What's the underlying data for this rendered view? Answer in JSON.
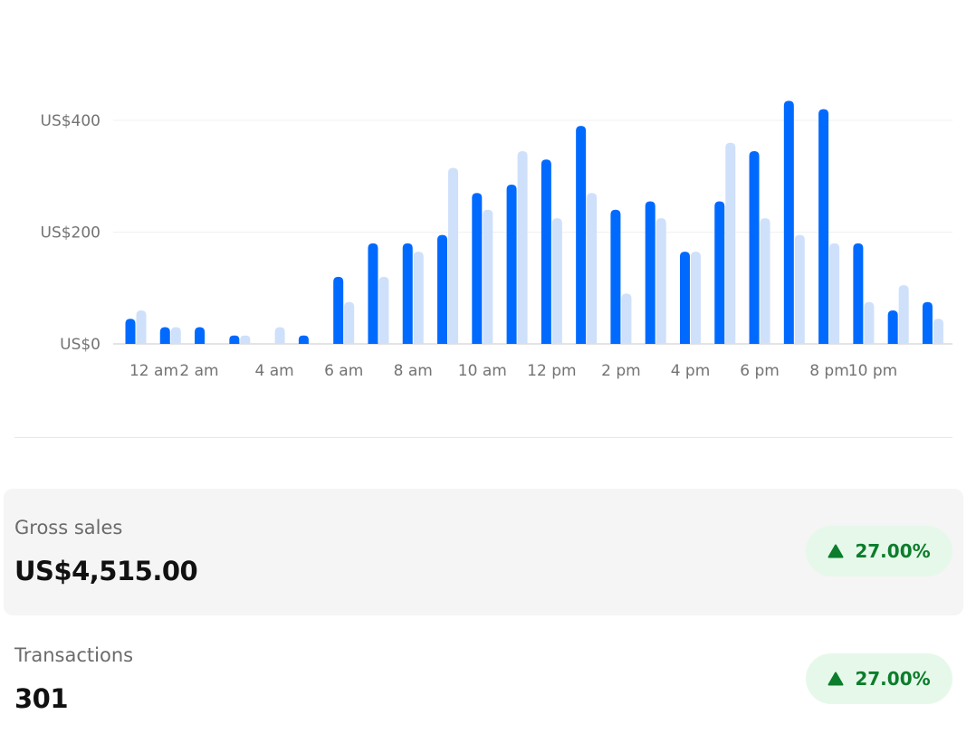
{
  "chart_data": {
    "type": "bar",
    "categories": [
      "12 am",
      "",
      "2 am",
      "",
      "4 am",
      "",
      "6 am",
      "",
      "8 am",
      "",
      "10 am",
      "",
      "12 pm",
      "",
      "2 pm",
      "",
      "4 pm",
      "",
      "6 pm",
      "",
      "8 pm",
      "10 pm",
      "",
      ""
    ],
    "series": [
      {
        "values": [
          45,
          30,
          30,
          15,
          0,
          15,
          120,
          180,
          180,
          195,
          270,
          285,
          330,
          390,
          240,
          255,
          165,
          255,
          345,
          435,
          420,
          180,
          60,
          75
        ],
        "color": "#006aff"
      },
      {
        "values": [
          60,
          30,
          0,
          15,
          30,
          0,
          75,
          120,
          165,
          315,
          240,
          345,
          225,
          270,
          90,
          225,
          165,
          360,
          225,
          195,
          180,
          75,
          105,
          45
        ],
        "color": "#cfe0fb"
      }
    ],
    "ylim": [
      0,
      400
    ],
    "y_ticks": [
      "US$0",
      "US$200",
      "US$400"
    ],
    "grid": true
  },
  "metrics": {
    "gross_sales": {
      "label": "Gross sales",
      "value": "US$4,515.00",
      "change": "27.00%"
    },
    "transactions": {
      "label": "Transactions",
      "value": "301",
      "change": "27.00%"
    }
  },
  "colors": {
    "positive_text": "#0b7d2b",
    "positive_bg": "#e6f8ea"
  }
}
